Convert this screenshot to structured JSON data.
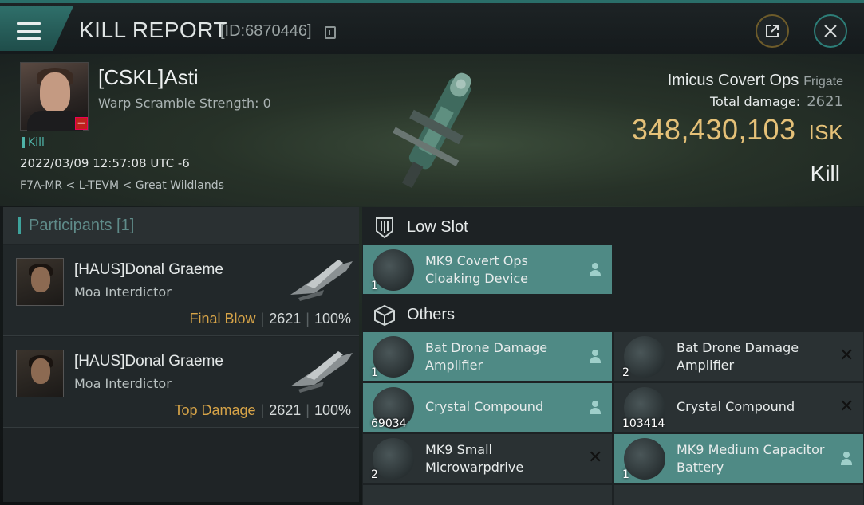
{
  "header": {
    "title": "KILL REPORT",
    "id_text": "[ID:6870446]"
  },
  "victim": {
    "name": "[CSKL]Asti",
    "warp_scramble": "Warp Scramble Strength: 0",
    "tag": "Kill",
    "datetime": "2022/03/09 12:57:08 UTC -6",
    "location": "F7A-MR < L-TEVM < Great Wildlands",
    "ship_name": "Imicus Covert Ops",
    "ship_class": "Frigate",
    "total_damage_label": "Total damage:",
    "total_damage": "2621",
    "isk_value": "348,430,103",
    "isk_unit": "ISK",
    "result": "Kill"
  },
  "participants": {
    "title": "Participants [1]",
    "rows": [
      {
        "name": "[HAUS]Donal Graeme",
        "ship": "Moa Interdictor",
        "label": "Final Blow",
        "damage": "2621",
        "percent": "100%"
      },
      {
        "name": "[HAUS]Donal Graeme",
        "ship": "Moa Interdictor",
        "label": "Top Damage",
        "damage": "2621",
        "percent": "100%"
      }
    ]
  },
  "sections": {
    "low_slot": "Low Slot",
    "others": "Others"
  },
  "items": {
    "low": [
      {
        "name": "MK9 Covert Ops Cloaking Device",
        "qty": "1",
        "status": "dropped"
      }
    ],
    "others": [
      {
        "name": "Bat Drone Damage Amplifier",
        "qty": "1",
        "status": "dropped"
      },
      {
        "name": "Bat Drone Damage Amplifier",
        "qty": "2",
        "status": "destroyed"
      },
      {
        "name": "Crystal Compound",
        "qty": "69034",
        "status": "dropped"
      },
      {
        "name": "Crystal Compound",
        "qty": "103414",
        "status": "destroyed"
      },
      {
        "name": "MK9 Small Microwarpdrive",
        "qty": "2",
        "status": "destroyed"
      },
      {
        "name": "MK9 Medium Capacitor Battery",
        "qty": "1",
        "status": "dropped"
      }
    ]
  },
  "colors": {
    "accent": "#3ea39c",
    "isk": "#e5c178",
    "dropped_bg": "#4f8a85",
    "label_gold": "#d7a448"
  }
}
